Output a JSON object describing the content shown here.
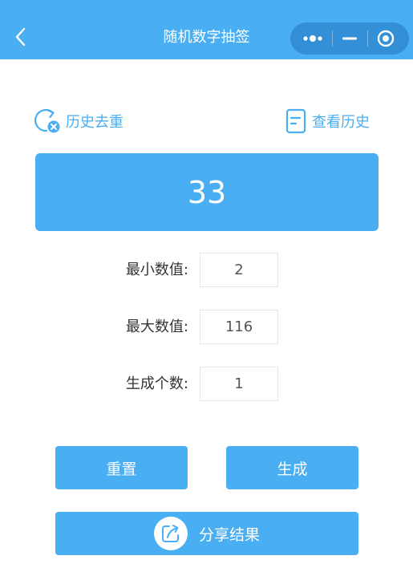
{
  "nav": {
    "title": "随机数字抽签",
    "back_icon": "chevron-left-icon",
    "menu_icons": [
      "more-dots-icon",
      "minimize-icon",
      "close-circle-icon"
    ]
  },
  "actions": {
    "dedupe_label": "历史去重",
    "dedupe_icon": "refresh-remove-icon",
    "history_label": "查看历史",
    "history_icon": "document-icon"
  },
  "result": {
    "value": "33"
  },
  "form": {
    "min": {
      "label": "最小数值:",
      "value": "2"
    },
    "max": {
      "label": "最大数值:",
      "value": "116"
    },
    "count": {
      "label": "生成个数:",
      "value": "1"
    }
  },
  "buttons": {
    "reset": "重置",
    "generate": "生成",
    "share": "分享结果",
    "share_icon": "share-icon"
  },
  "colors": {
    "accent": "#4aaef3",
    "text": "#333333",
    "border": "#e6e6e6"
  }
}
